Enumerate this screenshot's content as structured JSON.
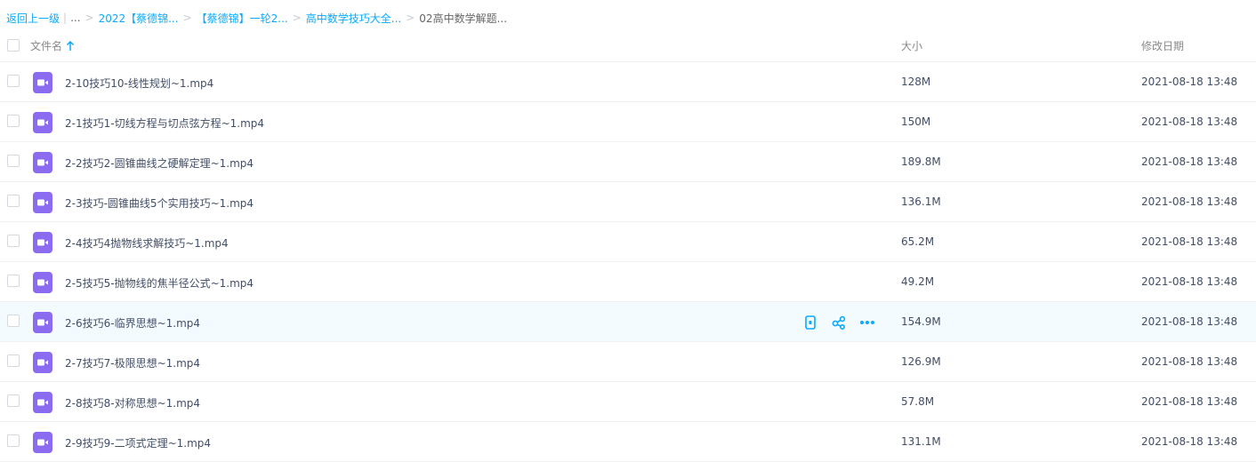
{
  "breadcrumb": {
    "back": "返回上一级",
    "pipe": "|",
    "ellipsis": "...",
    "sep": ">",
    "items": [
      "2022【蔡德锦...",
      "【蔡德锦】一轮2...",
      "高中数学技巧大全..."
    ],
    "current": "02高中数学解题..."
  },
  "header": {
    "name": "文件名",
    "size": "大小",
    "date": "修改日期",
    "sort_icon": "arrow-up-icon"
  },
  "colors": {
    "accent": "#09aaff",
    "video_icon": "#8b6cf0",
    "hover_row": "#f4fbff"
  },
  "files": [
    {
      "name": "2-10技巧10-线性规划~1.mp4",
      "size": "128M",
      "date": "2021-08-18 13:48"
    },
    {
      "name": "2-1技巧1-切线方程与切点弦方程~1.mp4",
      "size": "150M",
      "date": "2021-08-18 13:48"
    },
    {
      "name": "2-2技巧2-圆锥曲线之硬解定理~1.mp4",
      "size": "189.8M",
      "date": "2021-08-18 13:48"
    },
    {
      "name": "2-3技巧-圆锥曲线5个实用技巧~1.mp4",
      "size": "136.1M",
      "date": "2021-08-18 13:48"
    },
    {
      "name": "2-4技巧4抛物线求解技巧~1.mp4",
      "size": "65.2M",
      "date": "2021-08-18 13:48"
    },
    {
      "name": "2-5技巧5-抛物线的焦半径公式~1.mp4",
      "size": "49.2M",
      "date": "2021-08-18 13:48"
    },
    {
      "name": "2-6技巧6-临界思想~1.mp4",
      "size": "154.9M",
      "date": "2021-08-18 13:48"
    },
    {
      "name": "2-7技巧7-极限思想~1.mp4",
      "size": "126.9M",
      "date": "2021-08-18 13:48"
    },
    {
      "name": "2-8技巧8-对称思想~1.mp4",
      "size": "57.8M",
      "date": "2021-08-18 13:48"
    },
    {
      "name": "2-9技巧9-二项式定理~1.mp4",
      "size": "131.1M",
      "date": "2021-08-18 13:48"
    }
  ],
  "hovered_row": 6,
  "row_actions": [
    "phone-icon",
    "share-icon",
    "more-icon"
  ]
}
